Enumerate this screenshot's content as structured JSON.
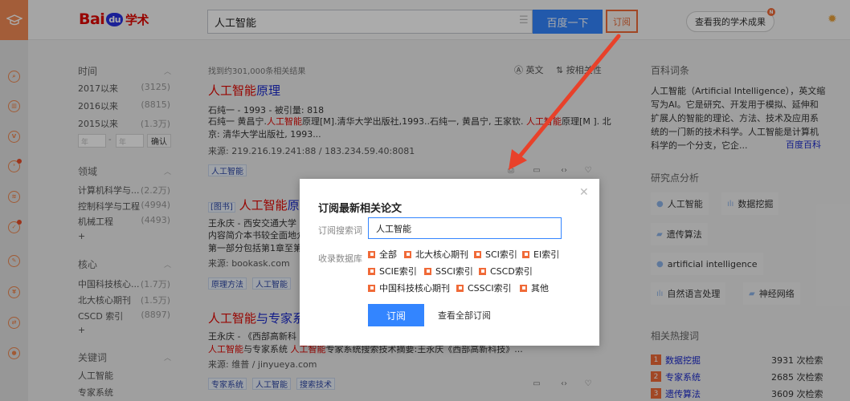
{
  "header": {
    "brand_red": "Bai",
    "brand_paw": "du",
    "brand_suffix": "学术",
    "search_value": "人工智能",
    "search_button": "百度一下",
    "subscribe_button": "订阅",
    "achievements_button": "查看我的学术成果",
    "achievements_badge": "N"
  },
  "filters": {
    "time": {
      "title": "时间",
      "items": [
        {
          "label": "2017以来",
          "count": "(3125)"
        },
        {
          "label": "2016以来",
          "count": "(8815)"
        },
        {
          "label": "2015以来",
          "count": "(1.3万)"
        }
      ],
      "year_from_placeholder": "年",
      "year_to_placeholder": "年",
      "confirm": "确认"
    },
    "field": {
      "title": "领域",
      "items": [
        {
          "label": "计算机科学与...",
          "count": "(2.2万)"
        },
        {
          "label": "控制科学与工程",
          "count": "(4994)"
        },
        {
          "label": "机械工程",
          "count": "(4493)"
        }
      ],
      "more": "+"
    },
    "core": {
      "title": "核心",
      "items": [
        {
          "label": "中国科技核心...",
          "count": "(1.7万)"
        },
        {
          "label": "北大核心期刊",
          "count": "(1.5万)"
        },
        {
          "label": "CSCD 索引",
          "count": "(8897)"
        }
      ],
      "more": "+"
    },
    "keyword": {
      "title": "关键词",
      "items": [
        {
          "label": "人工智能"
        },
        {
          "label": "专家系统"
        }
      ]
    }
  },
  "results": {
    "count_text": "找到约301,000条相关结果",
    "english_label": "英文",
    "sort_label": "按相关性",
    "items": [
      {
        "title_hl": "人工智能",
        "title_rest": "原理",
        "meta": "石纯一 - 1993 - 被引量: 818",
        "abstract_1a": "石纯一 黄昌宁.",
        "abstract_1hl": "人工智能",
        "abstract_1b": "原理[M].清华大学出版社,1993..石纯一, 黄昌宁, 王家钦. ",
        "abstract_1hl2": "人工智能",
        "abstract_1c": "原理[M ]. 北",
        "abstract_2": "京: 清华大学出版社, 1993...",
        "source": "来源:  219.216.19.241:88  /  183.234.59.40:8081",
        "tags": [
          "人工智能"
        ]
      },
      {
        "badge": "[图书]",
        "title_hl": "人工智能",
        "title_rest": "原",
        "meta": "王永庆 - 西安交通大学",
        "abstract_1": "内容简介本书较全面地介",
        "abstract_2": "第一部分包括第1章至第",
        "source": "来源:  bookask.com",
        "tags": [
          "原理方法",
          "人工智能"
        ]
      },
      {
        "title_hl": "人工智能",
        "title_rest": "与专家系",
        "meta": "王永庆 - 《西部高新科",
        "abstract_hl": "人工智能",
        "abstract_a": "与专家系统 ",
        "abstract_hl2": "人工智能",
        "abstract_b": "专家系统搜索技术摘要:王永庆《西部高新科技》...",
        "source": "来源:  维普  /  jinyueya.com",
        "tags": [
          "专家系统",
          "人工智能",
          "搜索技术"
        ]
      }
    ]
  },
  "sidebar": {
    "wiki_title": "百科词条",
    "wiki_text": "人工智能（Artificial Intelligence），英文缩写为AI。它是研究、开发用于模拟、延伸和扩展人的智能的理论、方法、技术及应用系统的一门新的技术科学。人工智能是计算机科学的一个分支，它企...",
    "wiki_link": "百度百科",
    "research_title": "研究点分析",
    "research_points": [
      "人工智能",
      "数据挖掘",
      "遗传算法",
      "artificial intelligence",
      "自然语言处理",
      "神经网络"
    ],
    "hot_title": "相关热搜词",
    "hot": [
      {
        "rank": "1",
        "term": "数据挖掘",
        "count": "3931 次检索"
      },
      {
        "rank": "2",
        "term": "专家系统",
        "count": "2685 次检索"
      },
      {
        "rank": "3",
        "term": "遗传算法",
        "count": "3609 次检索"
      }
    ]
  },
  "modal": {
    "title": "订阅最新相关论文",
    "keyword_label": "订阅搜索词",
    "keyword_value": "人工智能",
    "db_label": "收录数据库",
    "options": [
      "全部",
      "北大核心期刊",
      "SCI索引",
      "EI索引",
      "SCIE索引",
      "SSCI索引",
      "CSCD索引",
      "中国科技核心期刊",
      "CSSCI索引",
      "其他"
    ],
    "subscribe_button": "订阅",
    "view_all": "查看全部订阅"
  },
  "colors": {
    "accent_orange": "#f06a38",
    "baidu_blue": "#3385ff",
    "highlight_red": "#e10601",
    "arrow_red": "#e8412a"
  }
}
